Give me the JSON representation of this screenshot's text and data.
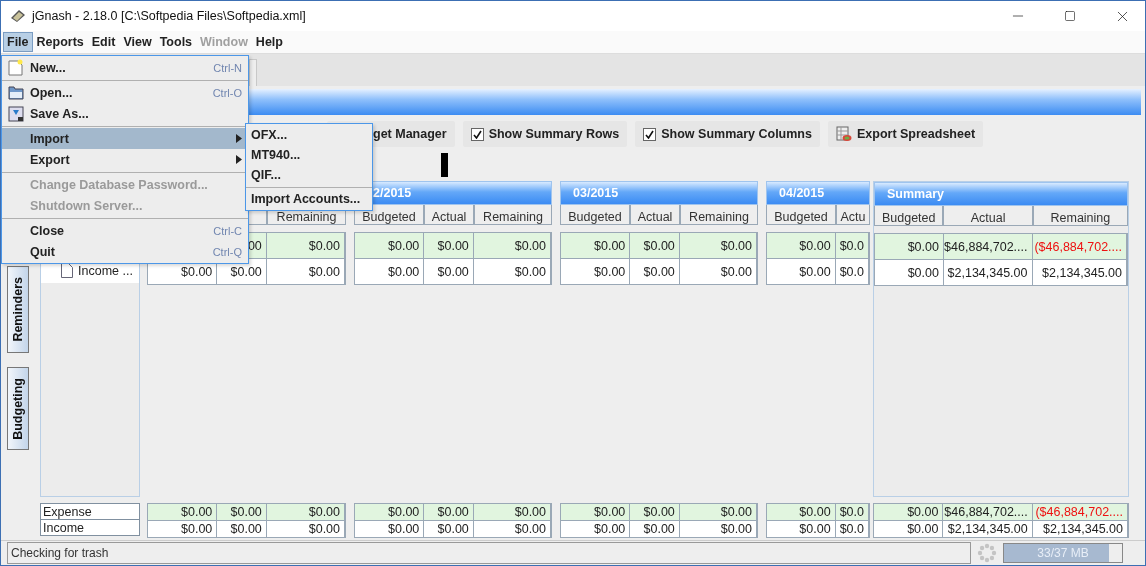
{
  "window": {
    "title": "jGnash - 2.18.0  [C:\\Softpedia Files\\Softpedia.xml]"
  },
  "menu_bar": [
    {
      "label": "File",
      "selected": true,
      "disabled": false
    },
    {
      "label": "Reports",
      "selected": false,
      "disabled": false
    },
    {
      "label": "Edit",
      "selected": false,
      "disabled": false
    },
    {
      "label": "View",
      "selected": false,
      "disabled": false
    },
    {
      "label": "Tools",
      "selected": false,
      "disabled": false
    },
    {
      "label": "Window",
      "selected": false,
      "disabled": true
    },
    {
      "label": "Help",
      "selected": false,
      "disabled": false
    }
  ],
  "file_menu": [
    {
      "kind": "item",
      "label": "New...",
      "shortcut": "Ctrl-N",
      "icon": true,
      "selected": false,
      "disabled": false,
      "submenu": false
    },
    {
      "kind": "separator"
    },
    {
      "kind": "item",
      "label": "Open...",
      "shortcut": "Ctrl-O",
      "icon": true,
      "selected": false,
      "disabled": false,
      "submenu": false
    },
    {
      "kind": "item",
      "label": "Save As...",
      "icon": true,
      "selected": false,
      "disabled": false,
      "submenu": false
    },
    {
      "kind": "separator"
    },
    {
      "kind": "item",
      "label": "Import",
      "icon": false,
      "selected": true,
      "disabled": false,
      "submenu": true
    },
    {
      "kind": "item",
      "label": "Export",
      "icon": false,
      "selected": false,
      "disabled": false,
      "submenu": true
    },
    {
      "kind": "separator"
    },
    {
      "kind": "item",
      "label": "Change Database Password...",
      "icon": false,
      "selected": false,
      "disabled": true,
      "submenu": false
    },
    {
      "kind": "item",
      "label": "Shutdown Server...",
      "icon": false,
      "selected": false,
      "disabled": true,
      "submenu": false
    },
    {
      "kind": "separator"
    },
    {
      "kind": "item",
      "label": "Close",
      "shortcut": "Ctrl-C",
      "icon": false,
      "selected": false,
      "disabled": false,
      "submenu": false
    },
    {
      "kind": "item",
      "label": "Quit",
      "shortcut": "Ctrl-Q",
      "icon": false,
      "selected": false,
      "disabled": false,
      "submenu": false
    }
  ],
  "import_submenu": [
    {
      "kind": "item",
      "label": "OFX..."
    },
    {
      "kind": "item",
      "label": "MT940..."
    },
    {
      "kind": "item",
      "label": "QIF..."
    },
    {
      "kind": "separator"
    },
    {
      "kind": "item",
      "label": "Import Accounts..."
    }
  ],
  "toolbar": [
    {
      "kind": "button",
      "label": "get Manager"
    },
    {
      "kind": "checkbox",
      "label": "Show Summary Rows",
      "checked": true
    },
    {
      "kind": "checkbox",
      "label": "Show Summary Columns",
      "checked": true
    },
    {
      "kind": "export",
      "label": "Export Spreadsheet"
    }
  ],
  "side_tabs": [
    {
      "label": "Reminders"
    },
    {
      "label": "Budgeting"
    }
  ],
  "accounts": [
    {
      "label": "Income ..."
    }
  ],
  "total_labels": [
    "Expense",
    "Income"
  ],
  "groups": [
    {
      "columns": [
        null,
        null,
        "Remaining"
      ],
      "rows": [
        {
          "highlighted": true,
          "cells": [
            null,
            "00",
            "$0.00"
          ]
        },
        {
          "highlighted": false,
          "cells": [
            "$0.00",
            "$0.00",
            "$0.00"
          ]
        }
      ],
      "totals": [
        {
          "highlighted": true,
          "cells": [
            "$0.00",
            "$0.00",
            "$0.00"
          ]
        },
        {
          "highlighted": false,
          "cells": [
            "$0.00",
            "$0.00",
            "$0.00"
          ]
        }
      ]
    },
    {
      "title": "2/2015",
      "columns": [
        "Budgeted",
        "Actual",
        "Remaining"
      ],
      "rows": [
        {
          "highlighted": true,
          "cells": [
            "$0.00",
            "$0.00",
            "$0.00"
          ]
        },
        {
          "highlighted": false,
          "cells": [
            "$0.00",
            "$0.00",
            "$0.00"
          ]
        }
      ],
      "totals": [
        {
          "highlighted": true,
          "cells": [
            "$0.00",
            "$0.00",
            "$0.00"
          ]
        },
        {
          "highlighted": false,
          "cells": [
            "$0.00",
            "$0.00",
            "$0.00"
          ]
        }
      ]
    },
    {
      "title": "03/2015",
      "columns": [
        "Budgeted",
        "Actual",
        "Remaining"
      ],
      "rows": [
        {
          "highlighted": true,
          "cells": [
            "$0.00",
            "$0.00",
            "$0.00"
          ]
        },
        {
          "highlighted": false,
          "cells": [
            "$0.00",
            "$0.00",
            "$0.00"
          ]
        }
      ],
      "totals": [
        {
          "highlighted": true,
          "cells": [
            "$0.00",
            "$0.00",
            "$0.00"
          ]
        },
        {
          "highlighted": false,
          "cells": [
            "$0.00",
            "$0.00",
            "$0.00"
          ]
        }
      ]
    },
    {
      "title": "04/2015",
      "columns": [
        "Budgeted",
        "Actu"
      ],
      "rows": [
        {
          "highlighted": true,
          "cells": [
            "$0.00",
            "$0.0"
          ]
        },
        {
          "highlighted": false,
          "cells": [
            "$0.00",
            "$0.0"
          ]
        }
      ],
      "totals": [
        {
          "highlighted": true,
          "cells": [
            "$0.00",
            "$0.0"
          ]
        },
        {
          "highlighted": false,
          "cells": [
            "$0.00",
            "$0.0"
          ]
        }
      ]
    },
    {
      "title": "Summary",
      "columns": [
        "Budgeted",
        "Actual",
        "Remaining"
      ],
      "rows": [
        {
          "highlighted": true,
          "cells": [
            "$0.00",
            "$46,884,702....",
            {
              "text": "($46,884,702....",
              "negative": true
            }
          ]
        },
        {
          "highlighted": false,
          "cells": [
            "$0.00",
            "$2,134,345.00",
            "$2,134,345.00"
          ]
        }
      ],
      "totals": [
        {
          "highlighted": true,
          "cells": [
            "$0.00",
            "$46,884,702....",
            {
              "text": "($46,884,702....",
              "negative": true
            }
          ]
        },
        {
          "highlighted": false,
          "cells": [
            "$0.00",
            "$2,134,345.00",
            "$2,134,345.00"
          ]
        }
      ]
    }
  ],
  "status_bar": {
    "message": "Checking for trash",
    "memory": {
      "text": "33/37 MB",
      "level": 0.89
    }
  }
}
